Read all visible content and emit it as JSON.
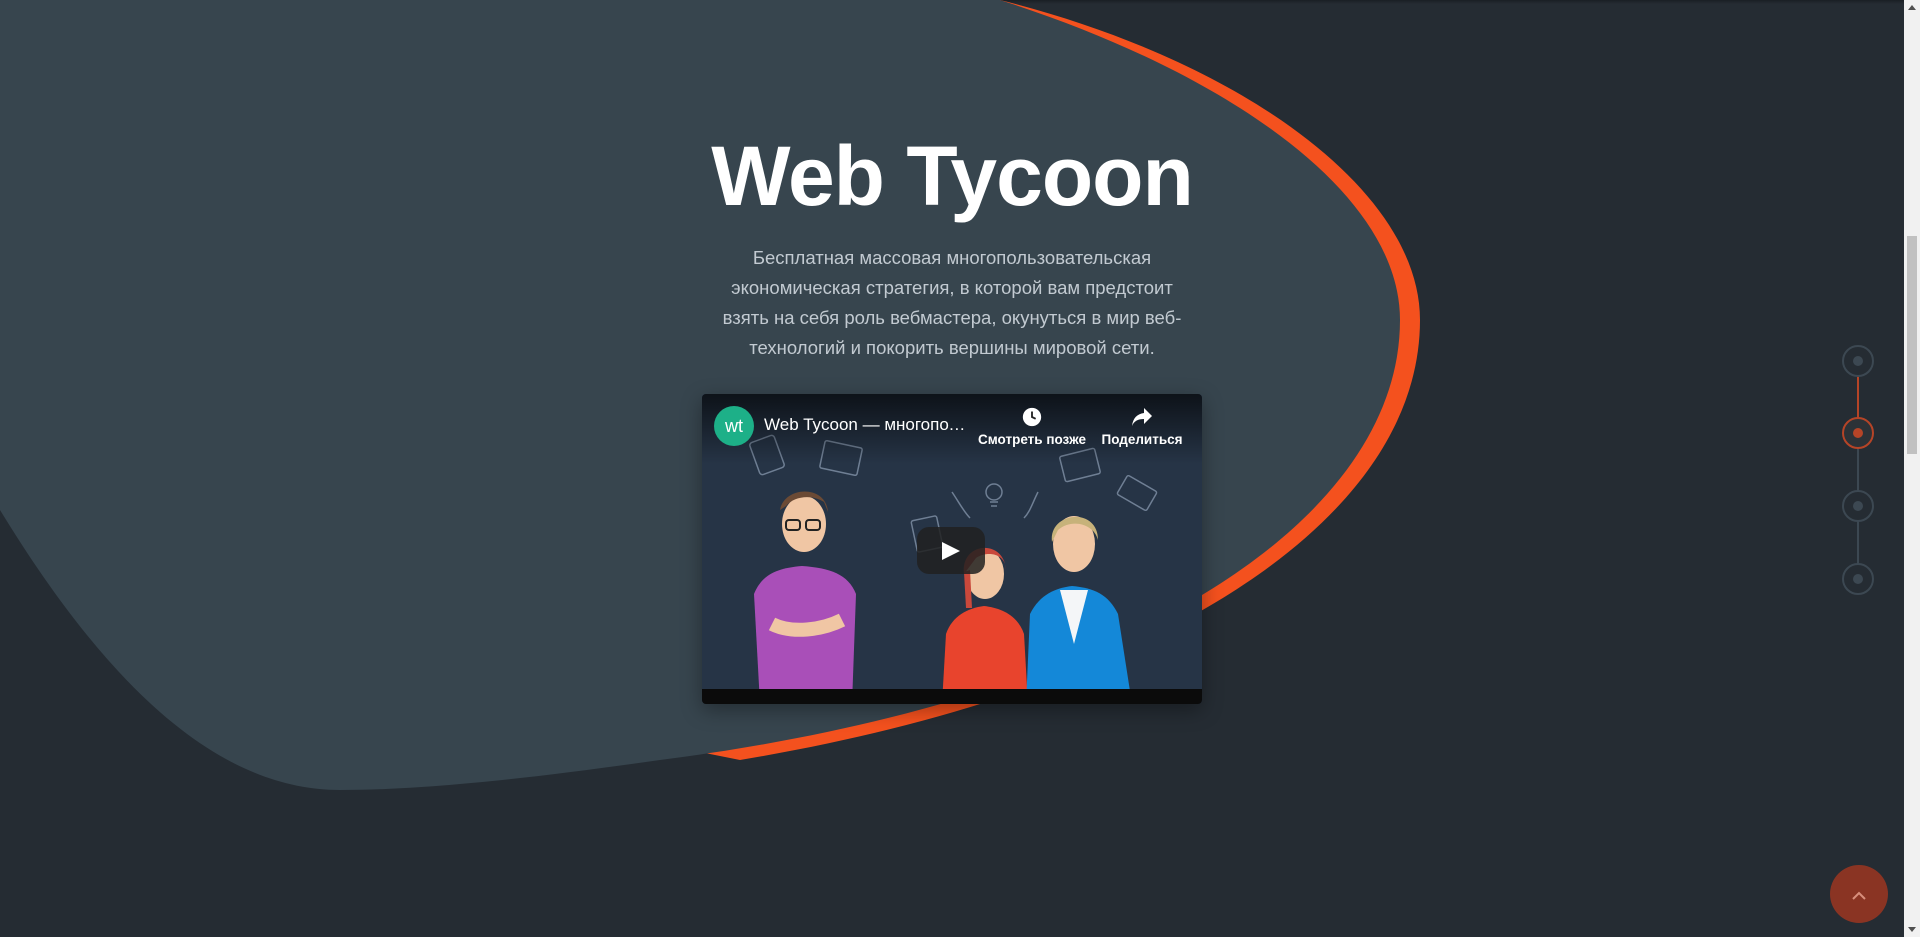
{
  "hero": {
    "title": "Web Tycoon",
    "subtitle": "Бесплатная массовая многопользовательская экономическая стратегия, в которой вам предстоит взять на себя роль вебмастера, окунуться в мир веб-технологий и покорить вершины мировой сети."
  },
  "video": {
    "channel_avatar_text": "wt",
    "title": "Web Tycoon — многопользовательская экономическая стратегия",
    "watch_later_label": "Смотреть позже",
    "share_label": "Поделиться"
  },
  "side_nav": {
    "active_index": 1,
    "dots": 4
  },
  "icons": {
    "clock": "clock-icon",
    "share": "share-arrow-icon",
    "play": "play-icon",
    "scroll_top": "chevron-up-icon"
  },
  "colors": {
    "background": "#252c33",
    "blob": "#37454e",
    "accent": "#f4511e",
    "accent_muted": "#b54427",
    "avatar": "#1db088"
  }
}
